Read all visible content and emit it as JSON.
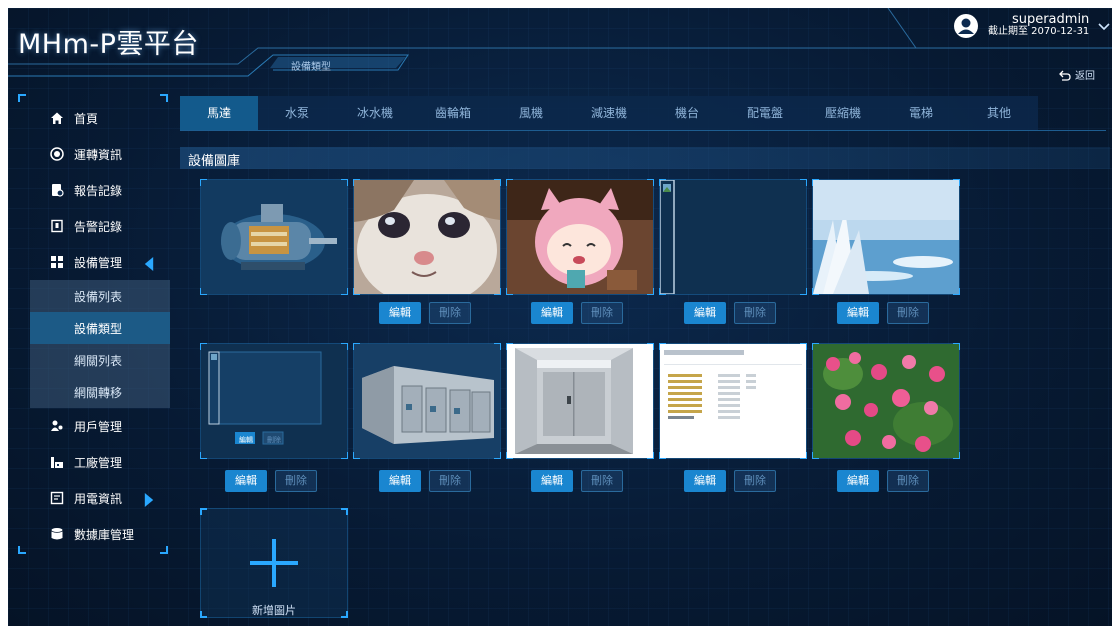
{
  "app": {
    "logo": "MHm-P雲平台",
    "page_tag": "設備類型",
    "back_label": "返回"
  },
  "user": {
    "name": "superadmin",
    "expiry": "截止期至 2070-12-31"
  },
  "sidebar": {
    "items": [
      {
        "label": "首頁",
        "icon": "home-icon"
      },
      {
        "label": "運轉資訊",
        "icon": "target-icon"
      },
      {
        "label": "報告記錄",
        "icon": "report-icon"
      },
      {
        "label": "告警記錄",
        "icon": "alarm-icon"
      },
      {
        "label": "設備管理",
        "icon": "grid-icon"
      },
      {
        "label": "用戶管理",
        "icon": "users-icon"
      },
      {
        "label": "工廠管理",
        "icon": "factory-icon"
      },
      {
        "label": "用電資訊",
        "icon": "power-icon"
      },
      {
        "label": "數據庫管理",
        "icon": "database-icon"
      }
    ],
    "submenu": [
      "設備列表",
      "設備類型",
      "網關列表",
      "網關轉移"
    ],
    "active_sub": "設備類型"
  },
  "tabs": [
    "馬達",
    "水泵",
    "冰水機",
    "齒輪箱",
    "風機",
    "減速機",
    "機台",
    "配電盤",
    "壓縮機",
    "電梯",
    "其他"
  ],
  "active_tab": "馬達",
  "gallery": {
    "title": "設備圖庫",
    "edit_label": "編輯",
    "delete_label": "刪除",
    "add_label": "新增圖片",
    "images": [
      {
        "desc": "motor-cutaway-image"
      },
      {
        "desc": "crying-cat-image"
      },
      {
        "desc": "anime-cat-girl-image"
      },
      {
        "desc": "broken-image"
      },
      {
        "desc": "frosted-lake-image"
      },
      {
        "desc": "broken-image-small"
      },
      {
        "desc": "switchgear-cabinet-image"
      },
      {
        "desc": "elevator-car-image"
      },
      {
        "desc": "file-listing-screenshot-image"
      },
      {
        "desc": "pink-flowers-image"
      }
    ],
    "mini_edit": "編輯",
    "mini_delete": "刪除"
  },
  "colors": {
    "accent": "#2aa8ff",
    "edit": "#1a86d0",
    "bg": "#071a33"
  }
}
